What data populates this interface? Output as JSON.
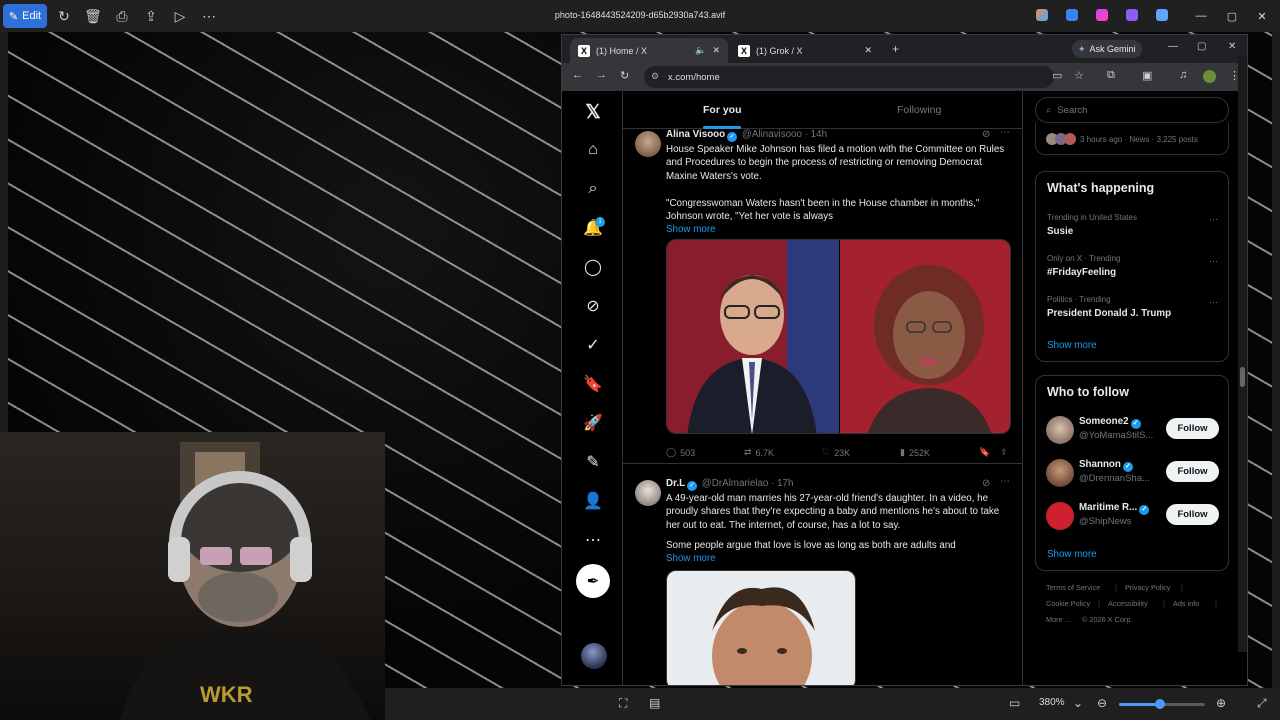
{
  "photos": {
    "edit_label": "Edit",
    "file_title": "photo-1648443524209-d65b2930a743.avif",
    "zoom": "380%"
  },
  "browser": {
    "tabs": [
      {
        "label": "(1) Home / X"
      },
      {
        "label": "(1) Grok / X"
      }
    ],
    "ask_gemini": "Ask Gemini",
    "url": "x.com/home"
  },
  "x": {
    "tabs": {
      "for_you": "For you",
      "following": "Following"
    },
    "notification_count": "1",
    "tweets": [
      {
        "name": "Alina Visooo",
        "handle": "@Alinavisooo",
        "time": "· 14h",
        "text1": "House Speaker Mike Johnson has filed a motion with the Committee on Rules and Procedures to begin the process of restricting or removing Democrat Maxine Waters's vote.",
        "text2": "\"Congresswoman Waters hasn't been in the House chamber in months,\" Johnson wrote, \"Yet her vote is always",
        "show_more": "Show more",
        "replies": "503",
        "reposts": "6.7K",
        "likes": "23K",
        "views": "252K"
      },
      {
        "name": "Dr.L",
        "handle": "@DrAlmarielao",
        "time": "· 17h",
        "text1": "A 49-year-old man marries his 27-year-old friend's daughter. In a video, he proudly shares that they're expecting a baby and mentions he's about to take her out to eat. The internet, of course, has a lot to say.",
        "text2": "Some people argue that love is love as long as both are adults and",
        "show_more": "Show more"
      }
    ],
    "sidebar": {
      "search_placeholder": "Search",
      "top_meta": "3 hours ago · News · 3,225 posts",
      "happening_title": "What's happening",
      "trends": [
        {
          "meta": "Trending in United States",
          "name": "Susie"
        },
        {
          "meta": "Only on X · Trending",
          "name": "#FridayFeeling"
        },
        {
          "meta": "Politics · Trending",
          "name": "President Donald J. Trump"
        }
      ],
      "show_more": "Show more",
      "wtf_title": "Who to follow",
      "wtf": [
        {
          "name": "Someone2",
          "handle": "@YoMamaStilS...",
          "button": "Follow"
        },
        {
          "name": "Shannon",
          "handle": "@DrennanSha...",
          "button": "Follow"
        },
        {
          "name": "Maritime R...",
          "handle": "@ShipNews",
          "button": "Follow"
        }
      ],
      "wtf_show_more": "Show more",
      "footer": {
        "terms": "Terms of Service",
        "privacy": "Privacy Policy",
        "cookie": "Cookie Policy",
        "accessibility": "Accessibility",
        "ads": "Ads info",
        "more": "More ...",
        "copyright": "© 2026 X Corp."
      }
    }
  },
  "colors": {
    "accent": "#1d9bf0",
    "edit": "#2f6fd8"
  }
}
